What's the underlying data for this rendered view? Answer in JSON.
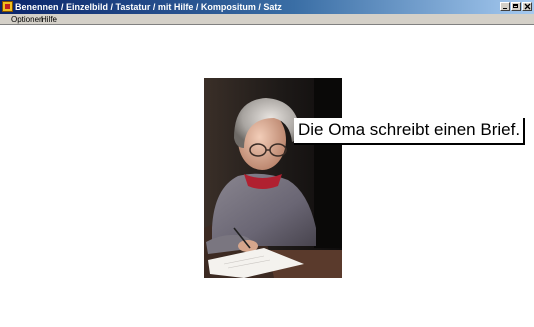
{
  "window": {
    "title": "Benennen / Einzelbild / Tastatur / mit Hilfe / Kompositum / Satz"
  },
  "menubar": {
    "items": [
      "Optionen",
      "Hilfe"
    ]
  },
  "exercise": {
    "caption": "Die Oma schreibt einen Brief."
  },
  "colors": {
    "titlebar_start": "#0a246a",
    "titlebar_end": "#a6caf0",
    "menubar_bg": "#d4d0c8",
    "background": "#ffffff"
  },
  "icons": [
    "app-icon",
    "minimize-icon",
    "maximize-icon",
    "close-icon"
  ]
}
